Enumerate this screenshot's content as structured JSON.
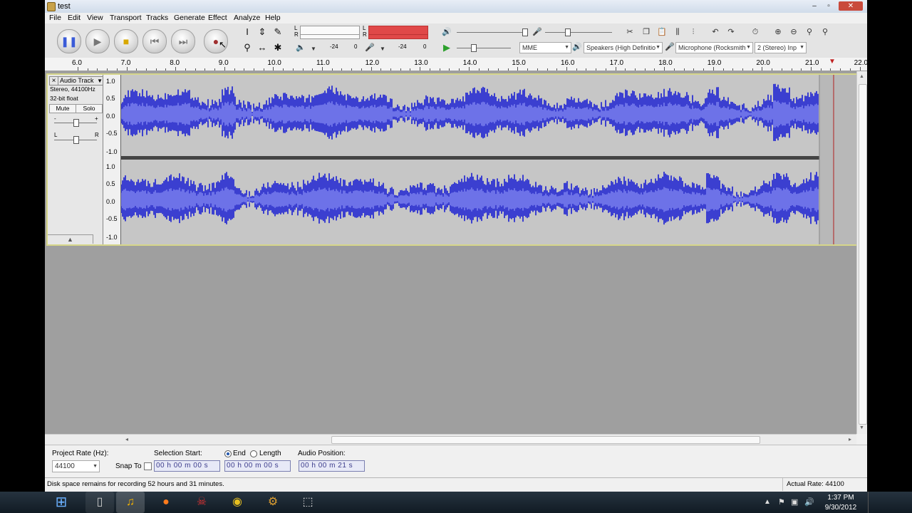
{
  "window": {
    "title": "test"
  },
  "menu": [
    "File",
    "Edit",
    "View",
    "Transport",
    "Tracks",
    "Generate",
    "Effect",
    "Analyze",
    "Help"
  ],
  "transport": {
    "buttons": [
      {
        "name": "pause-button",
        "glyph": "❚❚",
        "color": "#3a5bd8"
      },
      {
        "name": "play-button",
        "glyph": "▶",
        "color": "#777777"
      },
      {
        "name": "stop-button",
        "glyph": "■",
        "color": "#d8a800"
      },
      {
        "name": "skip-start-button",
        "glyph": "⏮",
        "color": "#777777"
      },
      {
        "name": "skip-end-button",
        "glyph": "⏭",
        "color": "#777777"
      },
      {
        "name": "record-button",
        "glyph": "●",
        "color": "#a03030"
      }
    ]
  },
  "meters": {
    "play_l": "L",
    "play_r": "R",
    "rec_l": "L",
    "rec_r": "R",
    "scale_play_a": "-24",
    "scale_play_b": "0",
    "scale_rec_a": "-24",
    "scale_rec_b": "0"
  },
  "device": {
    "host": "MME",
    "output": "Speakers (High Definitio",
    "input": "Microphone (Rocksmith",
    "channels": "2 (Stereo) Inp"
  },
  "ruler": {
    "ticks": [
      "6.0",
      "7.0",
      "8.0",
      "9.0",
      "10.0",
      "11.0",
      "12.0",
      "13.0",
      "14.0",
      "15.0",
      "16.0",
      "17.0",
      "18.0",
      "19.0",
      "20.0",
      "21.0",
      "22.0"
    ]
  },
  "track": {
    "close": "×",
    "name": "Audio Track",
    "info1": "Stereo, 44100Hz",
    "info2": "32-bit float",
    "mute": "Mute",
    "solo": "Solo",
    "gain_minus": "-",
    "gain_plus": "+",
    "pan_left": "L",
    "pan_right": "R",
    "collapse": "▲",
    "vruler": [
      "1.0",
      "0.5",
      "0.0",
      "-0.5",
      "-1.0"
    ]
  },
  "bottom": {
    "project_rate_label": "Project Rate (Hz):",
    "project_rate": "44100",
    "snap_label": "Snap To",
    "selection_start_label": "Selection Start:",
    "end_label": "End",
    "length_label": "Length",
    "audio_position_label": "Audio Position:",
    "selection_start": "00 h 00 m 00 s",
    "selection_end": "00 h 00 m 00 s",
    "audio_position": "00 h 00 m 21 s"
  },
  "status": {
    "disk": "Disk space remains for recording 52 hours and 31 minutes.",
    "rate": "Actual Rate: 44100"
  },
  "taskbar": {
    "time": "1:37 PM",
    "date": "9/30/2012",
    "apps": [
      "windows-start",
      "explorer",
      "media-player",
      "firefox",
      "game",
      "chrome",
      "settings",
      "snipping"
    ]
  },
  "colors": {
    "waveform": "#3b3fd0",
    "waveform_core": "#6d72e8",
    "meter_red": "#e04848"
  }
}
